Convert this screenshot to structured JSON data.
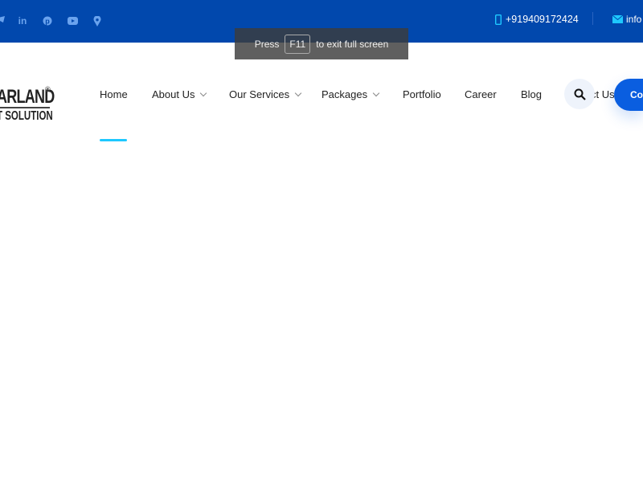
{
  "colors": {
    "brand": "#0148ad",
    "accent": "#1ec8ff",
    "cta": "#0a5ee0"
  },
  "topbar": {
    "social": [
      {
        "icon": "twitter-icon"
      },
      {
        "icon": "linkedin-icon",
        "glyph": "in"
      },
      {
        "icon": "pinterest-icon"
      },
      {
        "icon": "youtube-icon"
      },
      {
        "icon": "location-pin-icon"
      }
    ],
    "phone": "+919409172424",
    "email": "info"
  },
  "logo": {
    "line1": "ARLAND",
    "line2": "T SOLUTION",
    "reg": "®"
  },
  "nav": {
    "items": [
      {
        "label": "Home"
      },
      {
        "label": "About Us"
      },
      {
        "label": "Our Services"
      },
      {
        "label": "Packages"
      },
      {
        "label": "Portfolio"
      },
      {
        "label": "Career"
      },
      {
        "label": "Blog"
      },
      {
        "label": "ct Us"
      }
    ],
    "cta": "Co"
  },
  "overlay": {
    "press": "Press",
    "key": "F11",
    "rest": "to exit full screen"
  }
}
